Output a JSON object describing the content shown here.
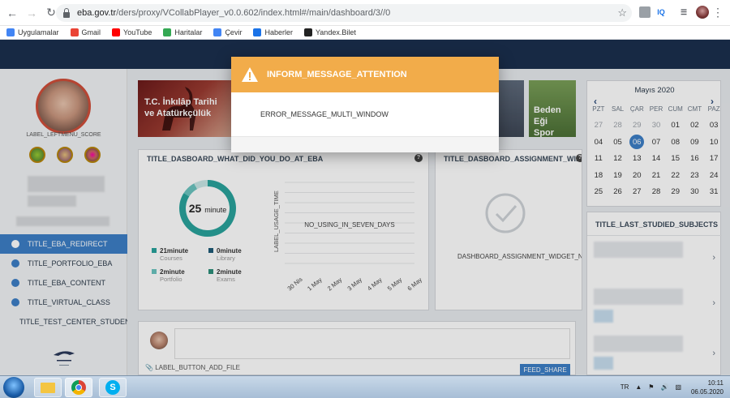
{
  "browser": {
    "url_host": "eba.gov.tr",
    "url_path": "/ders/proxy/VCollabPlayer_v0.0.602/index.html#/main/dashboard/3//0",
    "ext_iq": "IQ",
    "bookmarks": [
      {
        "label": "Uygulamalar",
        "color": "#4285f4"
      },
      {
        "label": "Gmail",
        "color": "#ea4335"
      },
      {
        "label": "YouTube",
        "color": "#ff0000"
      },
      {
        "label": "Haritalar",
        "color": "#34a853"
      },
      {
        "label": "Çevir",
        "color": "#4285f4"
      },
      {
        "label": "Haberler",
        "color": "#1a73e8"
      },
      {
        "label": "Yandex.Bilet",
        "color": "#222222"
      }
    ]
  },
  "sidebar": {
    "score_label": "LABEL_LEFTMENU_SCORE",
    "items": [
      {
        "label": "TITLE_EBA_REDIRECT",
        "icon": "user-icon",
        "active": true
      },
      {
        "label": "TITLE_PORTFOLIO_EBA",
        "icon": "portfolio-icon",
        "active": false
      },
      {
        "label": "TITLE_EBA_CONTENT",
        "icon": "play-icon",
        "active": false
      },
      {
        "label": "TITLE_VIRTUAL_CLASS",
        "icon": "video-icon",
        "active": false
      },
      {
        "label": "TITLE_TEST_CENTER_STUDENT",
        "icon": "pencil-icon",
        "active": false
      }
    ]
  },
  "banners": [
    {
      "text_line1": "T.C. İnkılâp Tarihi",
      "text_line2": "ve Atatürkçülük"
    },
    {
      "text_line1": "Beden Eği",
      "text_line2": "Spor"
    }
  ],
  "activity_widget": {
    "title": "TITLE_DASBOARD_WHAT_DID_YOU_DO_AT_EBA",
    "total_value": "25",
    "total_unit": "minute",
    "legend": [
      {
        "value": "21minute",
        "label": "Courses",
        "color": "#2aa39c"
      },
      {
        "value": "0minute",
        "label": "Library",
        "color": "#1f5c78"
      },
      {
        "value": "2minute",
        "label": "Portfolio",
        "color": "#6cc4c0"
      },
      {
        "value": "2minute",
        "label": "Exams",
        "color": "#2d8f7a"
      }
    ],
    "chart_ylabel": "LABEL_USAGE_TIME",
    "chart_empty": "NO_USING_IN_SEVEN_DAYS",
    "chart_xticks": [
      "30 Nis",
      "1 May",
      "2 May",
      "3 May",
      "4 May",
      "5 May",
      "6 May"
    ]
  },
  "assignment_widget": {
    "title": "TITLE_DASBOARD_ASSIGNMENT_WIDGET",
    "empty_text": "DASHBOARD_ASSIGNMENT_WIDGET_NO_ASSIGNMENT"
  },
  "modal": {
    "title": "INFORM_MESSAGE_ATTENTION",
    "message": "ERROR_MESSAGE_MULTI_WINDOW",
    "header_color": "#f2ac4a"
  },
  "calendar": {
    "month": "Mayıs 2020",
    "weekdays": [
      "PZT",
      "SAL",
      "ÇAR",
      "PER",
      "CUM",
      "CMT",
      "PAZ"
    ],
    "days": [
      [
        "27",
        "dim"
      ],
      [
        "28",
        "dim"
      ],
      [
        "29",
        "dim"
      ],
      [
        "30",
        "dim"
      ],
      [
        "01",
        ""
      ],
      [
        "02",
        ""
      ],
      [
        "03",
        ""
      ],
      [
        "04",
        ""
      ],
      [
        "05",
        ""
      ],
      [
        "06",
        "today"
      ],
      [
        "07",
        ""
      ],
      [
        "08",
        ""
      ],
      [
        "09",
        ""
      ],
      [
        "10",
        ""
      ],
      [
        "11",
        ""
      ],
      [
        "12",
        ""
      ],
      [
        "13",
        ""
      ],
      [
        "14",
        ""
      ],
      [
        "15",
        ""
      ],
      [
        "16",
        ""
      ],
      [
        "17",
        ""
      ],
      [
        "18",
        ""
      ],
      [
        "19",
        ""
      ],
      [
        "20",
        ""
      ],
      [
        "21",
        ""
      ],
      [
        "22",
        ""
      ],
      [
        "23",
        ""
      ],
      [
        "24",
        ""
      ],
      [
        "25",
        ""
      ],
      [
        "26",
        ""
      ],
      [
        "27",
        ""
      ],
      [
        "28",
        ""
      ],
      [
        "29",
        ""
      ],
      [
        "30",
        ""
      ],
      [
        "31",
        ""
      ]
    ]
  },
  "subjects_widget": {
    "title": "TITLE_LAST_STUDIED_SUBJECTS"
  },
  "feed": {
    "add_file_label": "LABEL_BUTTON_ADD_FILE",
    "share_label": "FEED_SHARE"
  },
  "taskbar": {
    "lang": "TR",
    "time": "10:11",
    "date": "06.05.2020"
  },
  "colors": {
    "accent": "#3d7fc6",
    "header": "#1b2f4e"
  }
}
